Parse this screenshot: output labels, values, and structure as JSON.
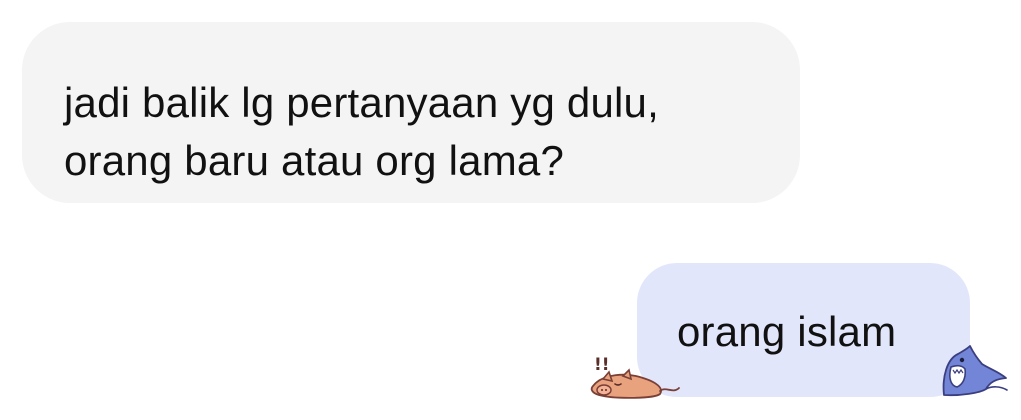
{
  "colors": {
    "background": "#ffffff",
    "incoming_bubble": "#f4f4f4",
    "outgoing_bubble": "#e1e6fb",
    "text": "#111111",
    "pig_sticker": "#e9a27e",
    "shark_sticker": "#7285d6"
  },
  "conversation": {
    "messages": [
      {
        "direction": "incoming",
        "lines": [
          "jadi balik lg pertanyaan yg dulu,",
          "orang baru atau org lama?"
        ]
      },
      {
        "direction": "outgoing",
        "lines": [
          "orang islam"
        ]
      }
    ]
  },
  "stickers": {
    "pig": {
      "icon": "sleeping-pig-icon",
      "exclamation": "!!"
    },
    "shark": {
      "icon": "shark-icon"
    }
  }
}
